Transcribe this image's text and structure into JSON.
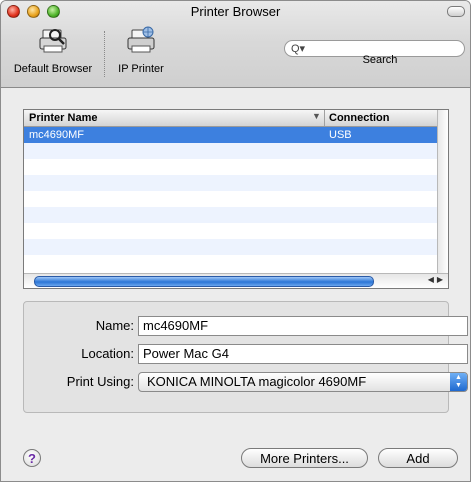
{
  "window": {
    "title": "Printer Browser"
  },
  "toolbar": {
    "default_browser_label": "Default Browser",
    "ip_printer_label": "IP Printer",
    "search_label": "Search",
    "search_value": ""
  },
  "table": {
    "columns": [
      "Printer Name",
      "Connection"
    ],
    "rows": [
      {
        "name": "mc4690MF",
        "connection": "USB",
        "selected": true
      }
    ]
  },
  "form": {
    "name_label": "Name:",
    "name_value": "mc4690MF",
    "location_label": "Location:",
    "location_value": "Power Mac G4",
    "print_using_label": "Print Using:",
    "print_using_value": "KONICA MINOLTA magicolor 4690MF"
  },
  "buttons": {
    "help": "?",
    "more_printers": "More Printers...",
    "add": "Add"
  },
  "colors": {
    "selection": "#3d80df",
    "alternate_row": "#edf3fe"
  }
}
